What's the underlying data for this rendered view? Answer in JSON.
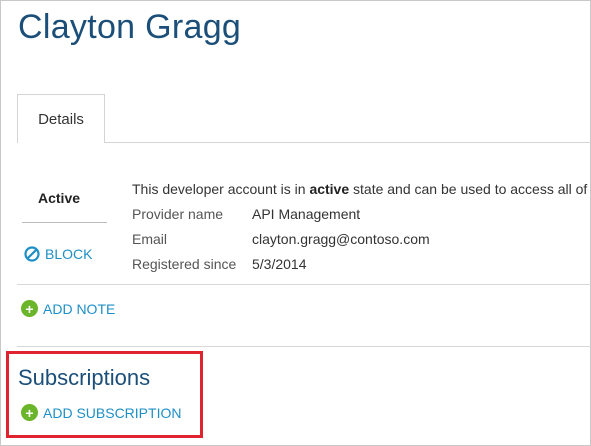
{
  "page": {
    "title": "Clayton Gragg"
  },
  "tabs": [
    {
      "label": "Details",
      "selected": true
    }
  ],
  "status": {
    "label": "Active"
  },
  "actions": {
    "block": "BLOCK",
    "add_note": "ADD NOTE",
    "add_subscription": "ADD SUBSCRIPTION"
  },
  "details": {
    "description_prefix": "This developer account is in ",
    "description_bold": "active",
    "description_suffix": " state and can be used to access all of th",
    "rows": [
      {
        "label": "Provider name",
        "value": "API Management"
      },
      {
        "label": "Email",
        "value": "clayton.gragg@contoso.com"
      },
      {
        "label": "Registered since",
        "value": "5/3/2014"
      }
    ]
  },
  "subscriptions": {
    "heading": "Subscriptions"
  },
  "colors": {
    "title": "#1b4f79",
    "link": "#1e8fc6",
    "add_icon": "#6bb52a",
    "highlight": "#e0242f"
  },
  "icons": {
    "block": "block-icon",
    "add": "plus-circle-icon"
  }
}
